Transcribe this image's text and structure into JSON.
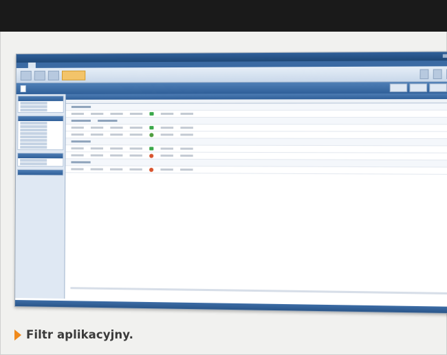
{
  "caption": {
    "text": "Filtr aplikacyjny."
  },
  "colors": {
    "top_band": "#1a1a1a",
    "window_blue": "#2f5f99",
    "caption_arrow": "#f08a1c",
    "allow_green": "#3aa84a",
    "deny_red": "#d8542e"
  },
  "icons": {
    "caption_marker": "orange-triangle-icon",
    "allow": "green-arrow-icon",
    "deny": "red-circle-icon"
  }
}
